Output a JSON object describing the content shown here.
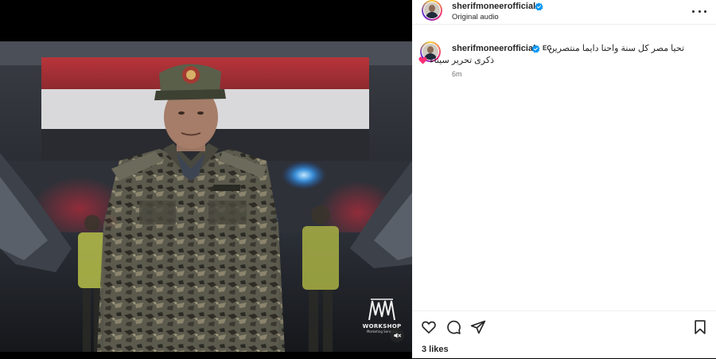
{
  "post": {
    "username": "sherifmoneerofficial",
    "audio": "Original audio",
    "caption": {
      "flag": "EG",
      "line1": "تحيا مصر كل سنة واحنا دايما منتصرين",
      "line2": "ذكرى تحرير سيناء"
    },
    "time": "6m",
    "likes": "3 likes"
  },
  "media": {
    "watermark": {
      "logo_text": "WORKSHOP",
      "sub_text": "Marketing Services"
    },
    "muted": true
  },
  "icons": {
    "more": "more-horizontal-icon",
    "verified": "verified-badge-icon",
    "like": "heart-outline-icon",
    "comment": "comment-bubble-icon",
    "share": "paper-plane-icon",
    "save": "bookmark-icon",
    "mute": "speaker-muted-icon",
    "caption_heart": "pink-heart-emoji"
  },
  "colors": {
    "verified": "#0095f6",
    "heart_emoji": "#ff2e74",
    "time": "#737373",
    "text": "#262626"
  }
}
